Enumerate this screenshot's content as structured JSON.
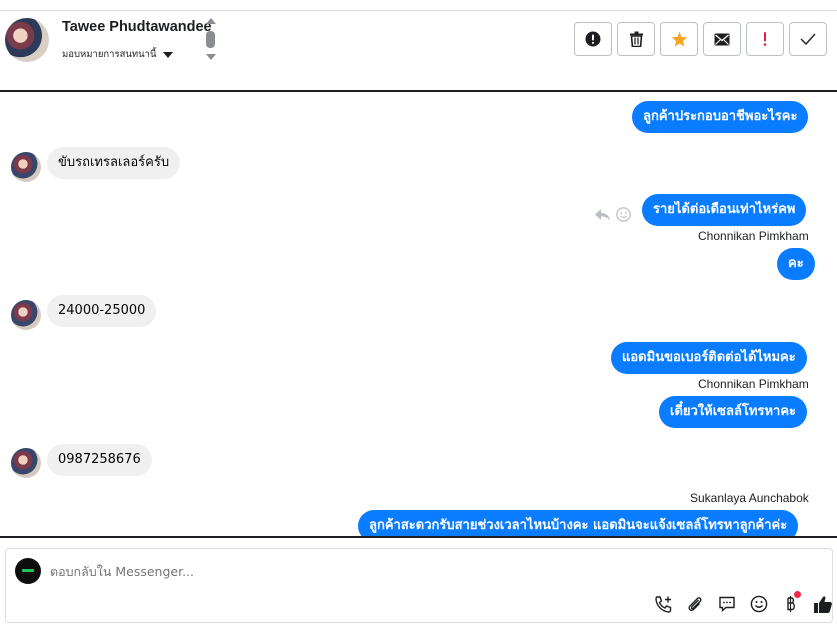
{
  "header": {
    "contact_name": "Tawee Phudtawandee",
    "assign_label": "มอบหมายการสนทนานี้",
    "actions": [
      {
        "name": "spam-report-button",
        "icon": "alert-circle-icon"
      },
      {
        "name": "delete-button",
        "icon": "trash-icon"
      },
      {
        "name": "star-button",
        "icon": "star-icon",
        "color": "#f5a623"
      },
      {
        "name": "mark-unread-button",
        "icon": "envelope-icon"
      },
      {
        "name": "follow-up-button",
        "icon": "exclamation-icon",
        "color": "#e41e3f"
      },
      {
        "name": "mark-done-button",
        "icon": "check-icon"
      }
    ]
  },
  "thread": {
    "messages": [
      {
        "dir": "out",
        "text": "ลูกค้าประกอบอาชีพอะไรคะ",
        "sender": ""
      },
      {
        "dir": "in",
        "text": "ขับรถเทรลเลอร์ครับ"
      },
      {
        "dir": "out",
        "text": "รายได้ต่อเดือนเท่าไหร่คพ",
        "sender": "Chonnikan Pimkham"
      },
      {
        "dir": "out",
        "text": "คะ"
      },
      {
        "dir": "in",
        "text": "24000-25000"
      },
      {
        "dir": "out",
        "text": "แอดมินขอเบอร์ติดต่อได้ไหมคะ",
        "sender": "Chonnikan Pimkham"
      },
      {
        "dir": "out",
        "text": "เดี๋ยวให้เซลล์โทรหาคะ"
      },
      {
        "dir": "in",
        "text": "0987258676"
      },
      {
        "sender_before": "Sukanlaya Aunchabok",
        "dir": "out",
        "text": "ลูกค้าสะดวกรับสายช่วงเวลาไหนบ้างคะ แอดมินจะแจ้งเซลล์โทรหาลูกค้าค่ะ"
      }
    ],
    "sender_labels": [
      "Chonnikan Pimkham",
      "Chonnikan Pimkham",
      "Sukanlaya Aunchabok"
    ]
  },
  "composer": {
    "placeholder": "ตอบกลับใน Messenger...",
    "tools": [
      "phone-plus-icon",
      "paperclip-icon",
      "saved-reply-icon",
      "emoji-icon",
      "baht-payment-icon",
      "thumbs-up-icon"
    ]
  },
  "colors": {
    "outgoing_bubble": "#0a7cff",
    "incoming_bubble": "#f0f0f0",
    "star": "#f5a623",
    "follow_up": "#e41e3f",
    "notification_dot": "#f0284a"
  }
}
